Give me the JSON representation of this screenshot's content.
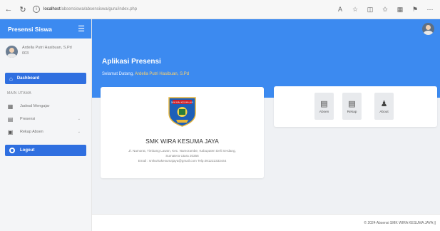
{
  "browser": {
    "url_host": "localhost",
    "url_path": "/absensiswa/absensiswa/guru/index.php",
    "icons": [
      "back-icon",
      "reload-icon",
      "info-icon",
      "read-aloud-icon",
      "favorite-icon",
      "split-icon",
      "favorites-icon",
      "collections-icon",
      "extensions-icon",
      "more-icon"
    ]
  },
  "sidebar": {
    "brand": "Presensi Siswa",
    "user_name": "Ardella Putri Hasibuan, S.Pd",
    "user_id": "003",
    "dashboard": "Dashboard",
    "section_title": "MAIN UTAMA",
    "items": [
      {
        "label": "Jadwal Mengajar",
        "icon": "calendar-icon",
        "has_chevron": false
      },
      {
        "label": "Presensi",
        "icon": "clipboard-icon",
        "has_chevron": true
      },
      {
        "label": "Rekap Absen",
        "icon": "table-icon",
        "has_chevron": true
      }
    ],
    "logout": "Logout"
  },
  "hero": {
    "title": "Aplikasi Presensi",
    "greeting": "Selamat Datang,",
    "user_highlight": "Ardella Putri Hasibuan, S.Pd"
  },
  "school": {
    "name": "SMK WIRA KESUMA JAYA",
    "address_line1": "Jl. Namorat, Timbang Lawan, Kec. Namorambe, Kabupaten Deli Serdang,",
    "address_line2": "Sumatera Utara 20356",
    "contact": "Email : smkwirakesumajaya@gmail.com Telp.081222333444",
    "logo_banner": "SMK WIRA KESUMA JAYA"
  },
  "actions": [
    {
      "label": "Absen",
      "icon": "clipboard-icon"
    },
    {
      "label": "Rekap",
      "icon": "list-icon"
    },
    {
      "label": "About",
      "icon": "user-icon"
    }
  ],
  "footer": {
    "text": "© 2024 Absensi SMK WIRA KESUMA JAYA ||"
  },
  "colors": {
    "primary": "#3c8af0",
    "primary_dark": "#2f6fe0",
    "highlight": "#ffd26a"
  }
}
